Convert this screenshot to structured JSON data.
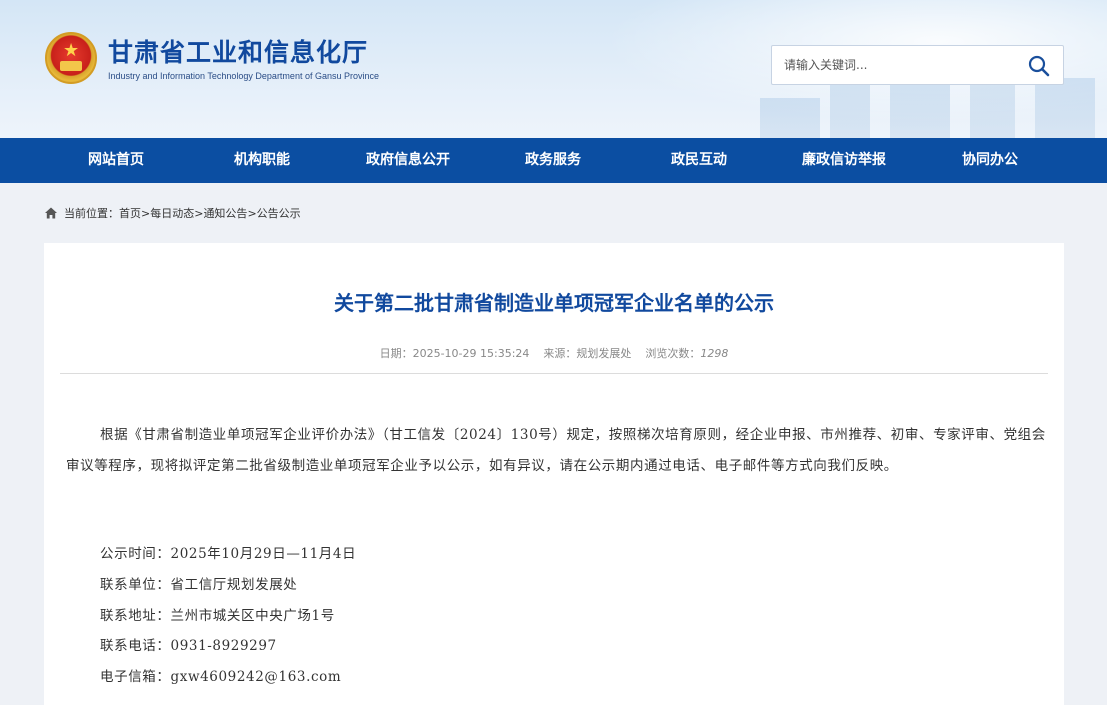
{
  "header": {
    "site_title": "甘肃省工业和信息化厅",
    "site_subtitle": "Industry and Information Technology Department of Gansu Province",
    "search_placeholder": "请输入关键词..."
  },
  "nav": {
    "items": [
      {
        "label": "网站首页"
      },
      {
        "label": "机构职能"
      },
      {
        "label": "政府信息公开"
      },
      {
        "label": "政务服务"
      },
      {
        "label": "政民互动"
      },
      {
        "label": "廉政信访举报"
      },
      {
        "label": "协同办公"
      }
    ]
  },
  "breadcrumb": {
    "prefix": "当前位置：",
    "items": [
      "首页",
      "每日动态",
      "通知公告",
      "公告公示"
    ],
    "separator": ">"
  },
  "article": {
    "title": "关于第二批甘肃省制造业单项冠军企业名单的公示",
    "meta_date": "日期：2025-10-29 15:35:24",
    "meta_source": "来源：规划发展处",
    "meta_views_label": "浏览次数：",
    "meta_views": "1298",
    "body": "根据《甘肃省制造业单项冠军企业评价办法》（甘工信发〔2024〕130号）规定，按照梯次培育原则，经企业申报、市州推荐、初审、专家评审、党组会审议等程序，现将拟评定第二批省级制造业单项冠军企业予以公示，如有异议，请在公示期内通过电话、电子邮件等方式向我们反映。",
    "info": [
      "公示时间：2025年10月29日—11月4日",
      "联系单位：省工信厅规划发展处",
      "联系地址：兰州市城关区中央广场1号",
      "联系电话：0931-8929297",
      "电子信箱：gxw4609242@163.com"
    ]
  },
  "colors": {
    "brand_blue": "#0b4ea2",
    "title_blue": "#11499e"
  }
}
